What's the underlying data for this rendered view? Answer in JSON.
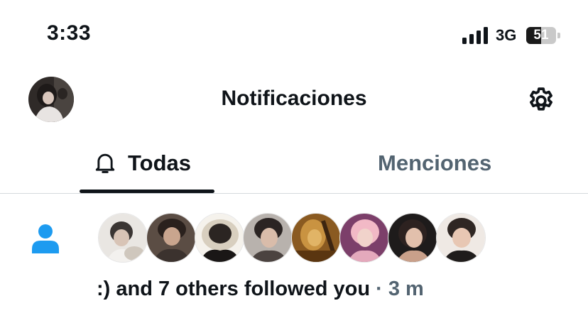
{
  "status_bar": {
    "time": "3:33",
    "network": "3G",
    "battery_level": "51",
    "battery_fraction": 0.51
  },
  "header": {
    "title": "Notificaciones",
    "profile_avatar_icon": "profile-avatar",
    "settings_icon": "gear-icon"
  },
  "tabs": {
    "all_label": "Todas",
    "all_icon": "bell-icon",
    "mentions_label": "Menciones",
    "active": "Todas"
  },
  "notifications": [
    {
      "type_icon": "person-icon",
      "text": ":) and 7 others followed you",
      "separator": "·",
      "time": "3 m",
      "avatar_count": 8
    }
  ],
  "colors": {
    "accent": "#1d9bf0",
    "text_primary": "#0f1419",
    "text_secondary": "#536471",
    "divider": "#d4d9dd"
  }
}
